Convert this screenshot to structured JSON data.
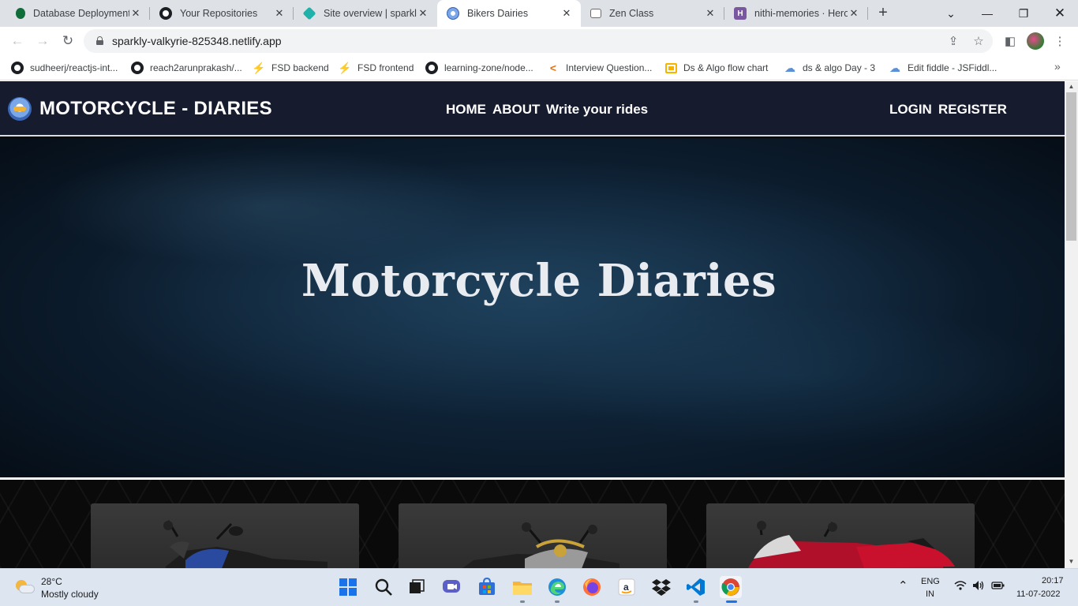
{
  "browser": {
    "tabs": [
      {
        "title": "Database Deployment",
        "icon": "mongodb-leaf-icon",
        "color": "#0f6d3a"
      },
      {
        "title": "Your Repositories",
        "icon": "github-icon",
        "color": "#1b1f23"
      },
      {
        "title": "Site overview | sparkly",
        "icon": "netlify-icon",
        "color": "#20b2aa"
      },
      {
        "title": "Bikers Dairies",
        "icon": "motorcycle-logo-icon",
        "color": "#3a66b5"
      },
      {
        "title": "Zen Class",
        "icon": "zen-class-icon",
        "color": "#6b6b6b"
      },
      {
        "title": "nithi-memories · Hero",
        "icon": "heroku-icon",
        "color": "#79589f"
      }
    ],
    "active_tab": "Bikers Dairies",
    "url": "sparkly-valkyrie-825348.netlify.app",
    "bookmarks": [
      {
        "label": "sudheerj/reactjs-int...",
        "icon": "github-icon"
      },
      {
        "label": "reach2arunprakash/...",
        "icon": "github-icon"
      },
      {
        "label": "FSD backend",
        "icon": "bolt-icon"
      },
      {
        "label": "FSD frontend",
        "icon": "bolt-icon"
      },
      {
        "label": "learning-zone/node...",
        "icon": "github-icon"
      },
      {
        "label": "Interview Question...",
        "icon": "interview-icon"
      },
      {
        "label": "Ds & Algo flow chart",
        "icon": "slides-icon"
      },
      {
        "label": "ds & algo Day - 3",
        "icon": "cloud-icon"
      },
      {
        "label": "Edit fiddle - JSFiddl...",
        "icon": "cloud-icon"
      }
    ]
  },
  "site": {
    "brand": "MOTORCYCLE - DIARIES",
    "nav": {
      "home": "HOME",
      "about": "ABOUT",
      "write": "Write your rides",
      "login": "LOGIN",
      "register": "REGISTER"
    },
    "hero_title": "Motorcycle Diaries",
    "cards": [
      {
        "image": "blue-black-naked-motorcycle"
      },
      {
        "image": "grey-gold-streetfighter-motorcycle"
      },
      {
        "image": "red-white-sport-motorcycle"
      }
    ]
  },
  "taskbar": {
    "weather": {
      "temp": "28°C",
      "condition": "Mostly cloudy"
    },
    "apps": [
      "start-icon",
      "search-icon",
      "task-view-icon",
      "chat-icon",
      "store-icon",
      "file-explorer-icon",
      "edge-icon",
      "firefox-icon",
      "amazon-icon",
      "dropbox-icon",
      "vscode-icon",
      "chrome-icon"
    ],
    "language": {
      "line1": "ENG",
      "line2": "IN"
    },
    "clock": {
      "time": "20:17",
      "date": "11-07-2022"
    }
  }
}
